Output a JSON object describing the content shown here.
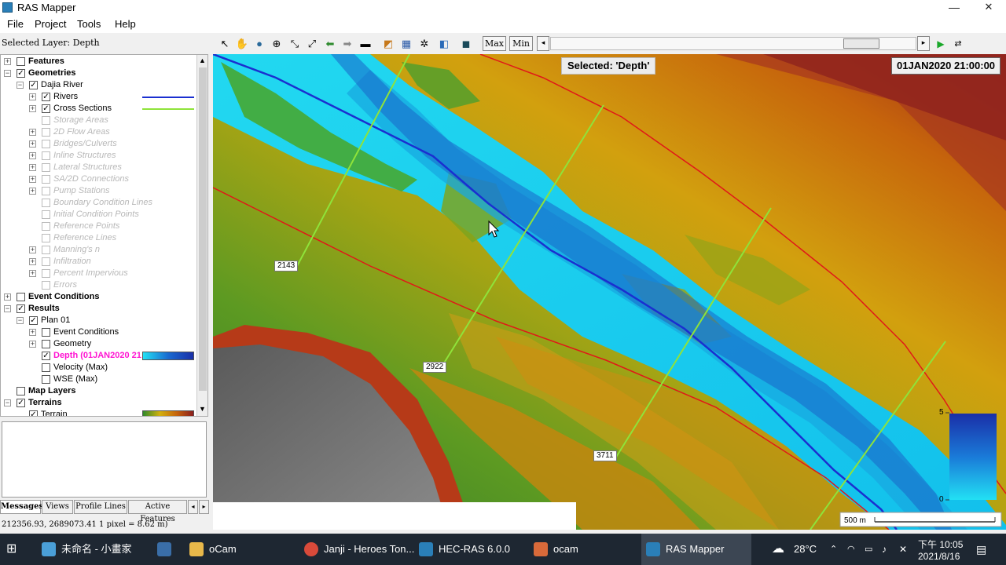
{
  "window": {
    "title": "RAS Mapper",
    "minimize": "—",
    "maximize": "❐",
    "close": "✕"
  },
  "menu": [
    "File",
    "Project",
    "Tools",
    "Help"
  ],
  "toolbar": {
    "selected_layer": "Selected Layer: Depth",
    "max_label": "Max",
    "min_label": "Min",
    "play": "▶"
  },
  "tree": {
    "nodes": [
      {
        "label": "Features",
        "exp": "+",
        "checked": false,
        "bold": true,
        "disabled": false
      },
      {
        "label": "Geometries",
        "exp": "−",
        "checked": true,
        "bold": true,
        "disabled": false
      },
      {
        "label": "Dajia River",
        "exp": "−",
        "checked": true,
        "bold": false,
        "disabled": false
      },
      {
        "label": "Rivers",
        "exp": "+",
        "checked": true,
        "bold": false,
        "disabled": false,
        "swatch": "#1a2fd0"
      },
      {
        "label": "Cross Sections",
        "exp": "+",
        "checked": true,
        "bold": false,
        "disabled": false,
        "swatch": "#8fe33a"
      },
      {
        "label": "Storage Areas",
        "exp": "",
        "checked": false,
        "bold": false,
        "disabled": true
      },
      {
        "label": "2D Flow Areas",
        "exp": "+",
        "checked": false,
        "bold": false,
        "disabled": true
      },
      {
        "label": "Bridges/Culverts",
        "exp": "+",
        "checked": false,
        "bold": false,
        "disabled": true
      },
      {
        "label": "Inline Structures",
        "exp": "+",
        "checked": false,
        "bold": false,
        "disabled": true
      },
      {
        "label": "Lateral Structures",
        "exp": "+",
        "checked": false,
        "bold": false,
        "disabled": true
      },
      {
        "label": "SA/2D Connections",
        "exp": "+",
        "checked": false,
        "bold": false,
        "disabled": true
      },
      {
        "label": "Pump Stations",
        "exp": "+",
        "checked": false,
        "bold": false,
        "disabled": true
      },
      {
        "label": "Boundary Condition Lines",
        "exp": "",
        "checked": false,
        "bold": false,
        "disabled": true
      },
      {
        "label": "Initial Condition Points",
        "exp": "",
        "checked": false,
        "bold": false,
        "disabled": true
      },
      {
        "label": "Reference Points",
        "exp": "",
        "checked": false,
        "bold": false,
        "disabled": true
      },
      {
        "label": "Reference Lines",
        "exp": "",
        "checked": false,
        "bold": false,
        "disabled": true
      },
      {
        "label": "Manning's n",
        "exp": "+",
        "checked": false,
        "bold": false,
        "disabled": true
      },
      {
        "label": "Infiltration",
        "exp": "+",
        "checked": false,
        "bold": false,
        "disabled": true
      },
      {
        "label": "Percent Impervious",
        "exp": "+",
        "checked": false,
        "bold": false,
        "disabled": true
      },
      {
        "label": "Errors",
        "exp": "",
        "checked": false,
        "bold": false,
        "disabled": true
      },
      {
        "label": "Event Conditions",
        "exp": "+",
        "checked": false,
        "bold": true,
        "disabled": false
      },
      {
        "label": "Results",
        "exp": "−",
        "checked": true,
        "bold": true,
        "disabled": false
      },
      {
        "label": "Plan 01",
        "exp": "−",
        "checked": true,
        "bold": false,
        "disabled": false
      },
      {
        "label": "Event Conditions",
        "exp": "+",
        "checked": false,
        "bold": false,
        "disabled": false
      },
      {
        "label": "Geometry",
        "exp": "+",
        "checked": false,
        "bold": false,
        "disabled": false
      },
      {
        "label": "Depth (01JAN2020 21",
        "exp": "",
        "checked": true,
        "bold": true,
        "disabled": false,
        "highlight": true,
        "gradient": "depth"
      },
      {
        "label": "Velocity (Max)",
        "exp": "",
        "checked": false,
        "bold": false,
        "disabled": false
      },
      {
        "label": "WSE (Max)",
        "exp": "",
        "checked": false,
        "bold": false,
        "disabled": false
      },
      {
        "label": "Map Layers",
        "exp": "",
        "checked": false,
        "bold": true,
        "disabled": false
      },
      {
        "label": "Terrains",
        "exp": "−",
        "checked": true,
        "bold": true,
        "disabled": false
      },
      {
        "label": "Terrain",
        "exp": "",
        "checked": true,
        "bold": false,
        "disabled": false,
        "gradient": "terrain"
      }
    ]
  },
  "bottom_tabs": [
    "Messages",
    "Views",
    "Profile Lines",
    "Active Features"
  ],
  "coords_text": "212356.93, 2689073.41   1 pixel = 8.62 m)",
  "map": {
    "selected_label": "Selected: 'Depth'",
    "timestamp": "01JAN2020 21:00:00",
    "cross_sections": [
      "2143",
      "2922",
      "3711"
    ],
    "legend": {
      "max": "5",
      "min": "0"
    },
    "scale_label": "500 m"
  },
  "taskbar": {
    "items": [
      {
        "label": "未命名 - 小畫家",
        "color": "#4a9fd8"
      },
      {
        "label": "",
        "color": "#3a6ea8"
      },
      {
        "label": "oCam",
        "color": "#e8b84a"
      },
      {
        "label": "Janji - Heroes Ton...",
        "color": "#d94a3a"
      },
      {
        "label": "HEC-RAS 6.0.0",
        "color": "#2a7fb8"
      },
      {
        "label": "ocam",
        "color": "#d96a3a"
      },
      {
        "label": "RAS Mapper",
        "color": "#2a7fb8"
      }
    ],
    "weather": "28°C",
    "time": "下午 10:05",
    "date": "2021/8/16"
  },
  "colors": {
    "river": "#1a2fd0",
    "cross_section": "#8fe33a",
    "bank": "#e01818",
    "water_light": "#22d8f0",
    "water_deep": "#1844b8"
  }
}
